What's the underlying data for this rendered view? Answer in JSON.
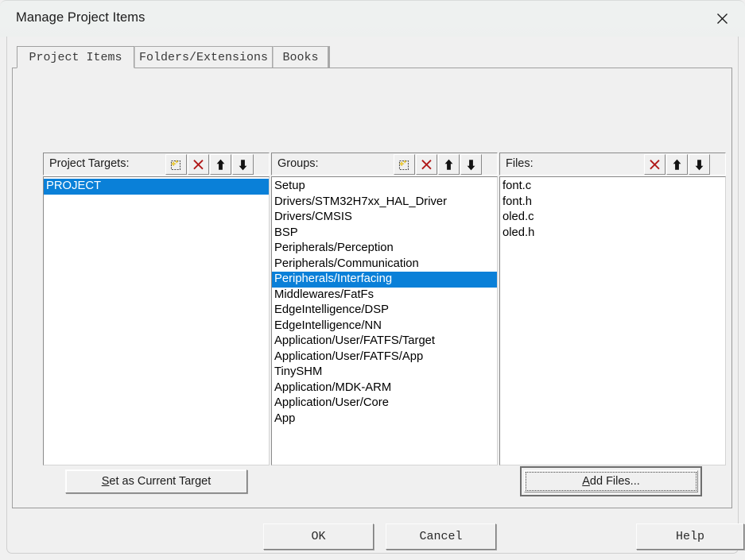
{
  "window": {
    "title": "Manage Project Items",
    "close_icon": "close-icon"
  },
  "tabs": [
    {
      "label": "Project Items",
      "active": true
    },
    {
      "label": "Folders/Extensions",
      "active": false
    },
    {
      "label": "Books",
      "active": false
    }
  ],
  "columns": {
    "targets": {
      "label": "Project Targets:",
      "tools": [
        {
          "name": "new-item-icon",
          "title": "New (Insert)"
        },
        {
          "name": "delete-icon",
          "title": "Remove Item"
        },
        {
          "name": "move-up-icon",
          "title": "Move Up"
        },
        {
          "name": "move-down-icon",
          "title": "Move Down"
        }
      ],
      "items": [
        {
          "label": "PROJECT",
          "selected": true
        }
      ]
    },
    "groups": {
      "label": "Groups:",
      "tools": [
        {
          "name": "new-item-icon",
          "title": "New (Insert)"
        },
        {
          "name": "delete-icon",
          "title": "Remove Item"
        },
        {
          "name": "move-up-icon",
          "title": "Move Up"
        },
        {
          "name": "move-down-icon",
          "title": "Move Down"
        }
      ],
      "items": [
        {
          "label": "Setup",
          "selected": false
        },
        {
          "label": "Drivers/STM32H7xx_HAL_Driver",
          "selected": false
        },
        {
          "label": "Drivers/CMSIS",
          "selected": false
        },
        {
          "label": "BSP",
          "selected": false
        },
        {
          "label": "Peripherals/Perception",
          "selected": false
        },
        {
          "label": "Peripherals/Communication",
          "selected": false
        },
        {
          "label": "Peripherals/Interfacing",
          "selected": true
        },
        {
          "label": "Middlewares/FatFs",
          "selected": false
        },
        {
          "label": "EdgeIntelligence/DSP",
          "selected": false
        },
        {
          "label": "EdgeIntelligence/NN",
          "selected": false
        },
        {
          "label": "Application/User/FATFS/Target",
          "selected": false
        },
        {
          "label": "Application/User/FATFS/App",
          "selected": false
        },
        {
          "label": "TinySHM",
          "selected": false
        },
        {
          "label": "Application/MDK-ARM",
          "selected": false
        },
        {
          "label": "Application/User/Core",
          "selected": false
        },
        {
          "label": "App",
          "selected": false
        }
      ]
    },
    "files": {
      "label": "Files:",
      "tools": [
        {
          "name": "delete-icon",
          "title": "Remove Item"
        },
        {
          "name": "move-up-icon",
          "title": "Move Up"
        },
        {
          "name": "move-down-icon",
          "title": "Move Down"
        }
      ],
      "items": [
        {
          "label": "font.c",
          "selected": false
        },
        {
          "label": "font.h",
          "selected": false
        },
        {
          "label": "oled.c",
          "selected": false
        },
        {
          "label": "oled.h",
          "selected": false
        }
      ]
    }
  },
  "actions": {
    "set_as_current_target": {
      "accel": "S",
      "rest": "et as Current Target"
    },
    "add_files": {
      "accel": "A",
      "rest": "dd Files..."
    }
  },
  "footer": {
    "ok": "OK",
    "cancel": "Cancel",
    "help": "Help"
  },
  "colors": {
    "selection": "#0a80d8",
    "dialog_face": "#f0f0f0",
    "delete_icon": "#b01818",
    "new_icon_sparkle": "#f5d33c"
  }
}
